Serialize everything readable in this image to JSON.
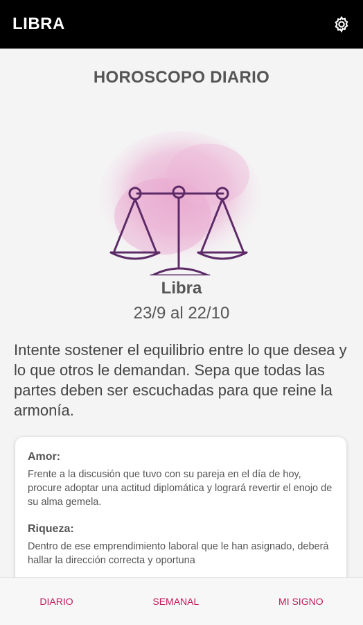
{
  "appbar": {
    "title": "LIBRA",
    "settings_icon": "gear-icon"
  },
  "main": {
    "section_title": "HOROSCOPO DIARIO",
    "sign_image": "libra-scales-icon",
    "sign_name": "Libra",
    "sign_dates": "23/9 al 22/10",
    "prediction": "Intente sostener el equilibrio entre lo que desea y lo que otros le demandan. Sepa que todas las partes deben ser escuchadas para que reine la armonía."
  },
  "card": {
    "sections": [
      {
        "heading": "Amor:",
        "text": "Frente a la discusión que tuvo con su pareja en el día de hoy, procure adoptar una actitud diplomática y logrará revertir el enojo de su alma gemela."
      },
      {
        "heading": "Riqueza:",
        "text": "Dentro de ese emprendimiento laboral que le han asignado, deberá hallar la dirección correcta y oportuna"
      }
    ]
  },
  "bottom_nav": {
    "items": [
      {
        "label": "DIARIO"
      },
      {
        "label": "SEMANAL"
      },
      {
        "label": "MI SIGNO"
      }
    ]
  },
  "colors": {
    "appbar_bg": "#000000",
    "accent": "#c2185b",
    "background": "#f4f4f4"
  }
}
